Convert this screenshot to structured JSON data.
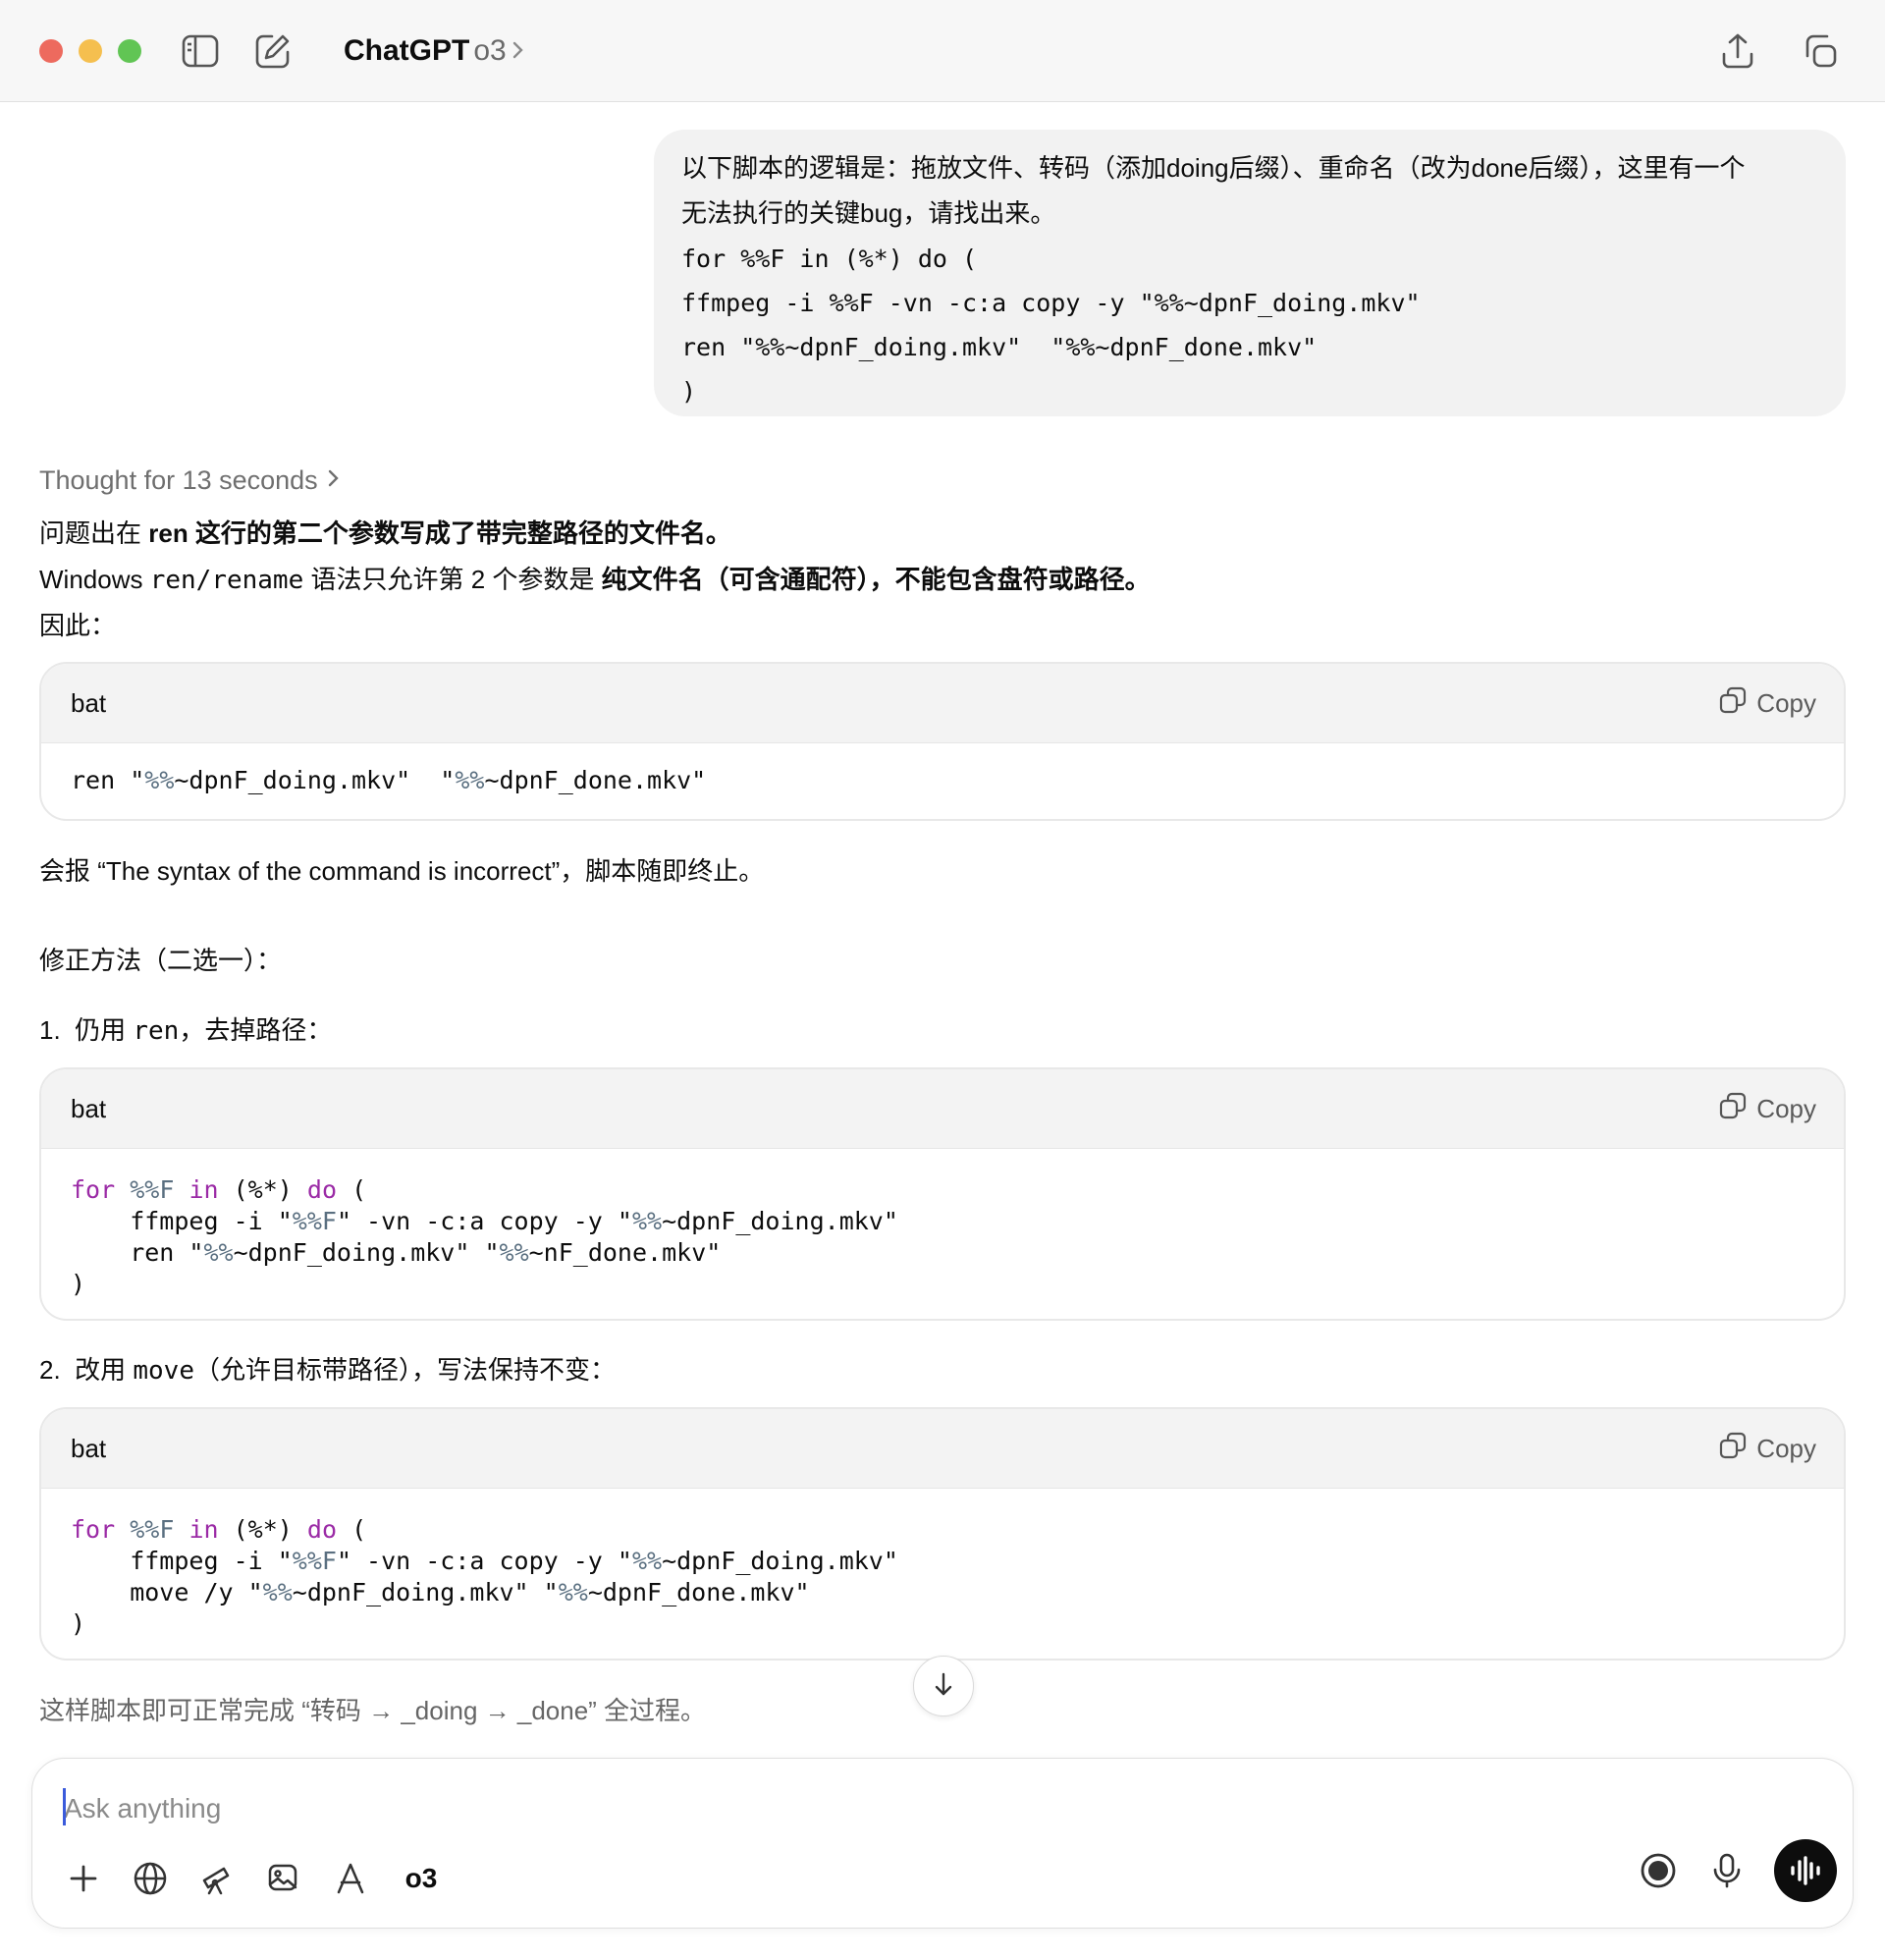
{
  "window": {
    "title": "ChatGPT",
    "model": "o3"
  },
  "user_message": {
    "text_line1": "以下脚本的逻辑是：拖放文件、转码（添加doing后缀）、重命名（改为done后缀），这里有一个",
    "text_line2": "无法执行的关键bug，请找出来。",
    "code_lines": [
      "for %%F in (%*) do (",
      "ffmpeg -i %%F -vn -c:a copy -y \"%%~dpnF_doing.mkv\"",
      "ren \"%%~dpnF_doing.mkv\"  \"%%~dpnF_done.mkv\"",
      ")"
    ]
  },
  "assistant": {
    "thought": "Thought for 13 seconds",
    "p1_pre": "问题出在 ",
    "p1_bold": "ren 这行的第二个参数写成了带完整路径的文件名。",
    "p2_pre": "Windows ",
    "p2_code": "ren/rename",
    "p2_mid": " 语法只允许第 2 个参数是 ",
    "p2_bold": "纯文件名（可含通配符），不能包含盘符或路径。",
    "p3": "因此：",
    "p4": "会报 “The syntax of the command is incorrect”，脚本随即终止。",
    "p5": "修正方法（二选一）：",
    "item1_pre": "1.  仍用 ",
    "item1_code": "ren",
    "item1_post": "，去掉路径：",
    "item2_pre": "2.  改用 ",
    "item2_code": "move",
    "item2_post": "（允许目标带路径），写法保持不变：",
    "final": "这样脚本即可正常完成 “转码 → _doing → _done” 全过程。",
    "code1": {
      "lang": "bat",
      "copy": "Copy",
      "t1": "ren \"",
      "t2": "%%",
      "t3": "~dpnF_doing.mkv\"  \"",
      "t4": "%%",
      "t5": "~dpnF_done.mkv\""
    },
    "code2": {
      "lang": "bat",
      "copy": "Copy",
      "kw_for": "for",
      "var_F": "%%F",
      "kw_in": "in",
      "args": "(%*)",
      "kw_do": "do",
      "paren_open": "(",
      "l2a": "    ffmpeg -i \"",
      "l2b": "%%F",
      "l2c": "\" -vn -c:a copy -y \"",
      "l2d": "%%",
      "l2e": "~dpnF_doing.mkv\"",
      "l3a": "    ren \"",
      "l3b": "%%",
      "l3c": "~dpnF_doing.mkv\" \"",
      "l3d": "%%",
      "l3e": "~nF_done.mkv\"",
      "paren_close": ")"
    },
    "code3": {
      "lang": "bat",
      "copy": "Copy",
      "kw_for": "for",
      "var_F": "%%F",
      "kw_in": "in",
      "args": "(%*)",
      "kw_do": "do",
      "paren_open": "(",
      "l2a": "    ffmpeg -i \"",
      "l2b": "%%F",
      "l2c": "\" -vn -c:a copy -y \"",
      "l2d": "%%",
      "l2e": "~dpnF_doing.mkv\"",
      "l3a": "    move /y \"",
      "l3b": "%%",
      "l3c": "~dpnF_doing.mkv\" \"",
      "l3d": "%%",
      "l3e": "~dpnF_done.mkv\"",
      "paren_close": ")"
    }
  },
  "composer": {
    "placeholder": "Ask anything",
    "model": "o3"
  }
}
